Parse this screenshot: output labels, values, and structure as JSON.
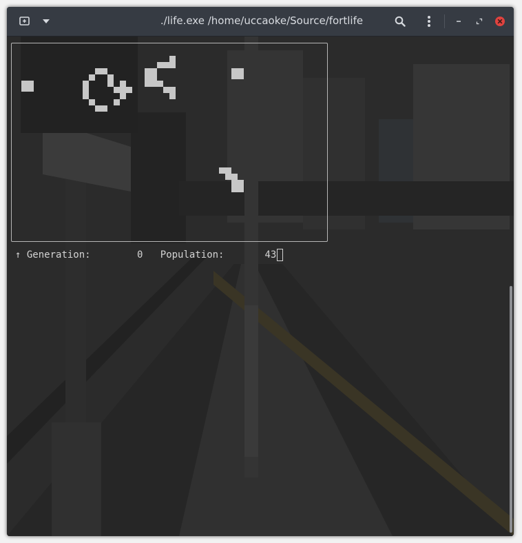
{
  "window": {
    "title": "./life.exe /home/uccaoke/Source/fortlife"
  },
  "toolbar": {
    "new_tab_icon": "new-tab-icon",
    "menu_icon": "chevron-down-icon",
    "search_icon": "search-icon",
    "more_icon": "kebab-menu-icon",
    "minimize_icon": "minimize-icon",
    "maximize_icon": "restore-icon",
    "close_icon": "close-icon",
    "close_color": "#e0433f"
  },
  "status": {
    "arrow": "↑",
    "generation_label": "Generation:",
    "generation_value": "0",
    "population_label": "Population:",
    "population_value": "43"
  },
  "colors": {
    "cell": "#c7c7c7",
    "frame": "#b8b8b8",
    "text": "#d3d3d3",
    "titlebar": "#363b43"
  }
}
